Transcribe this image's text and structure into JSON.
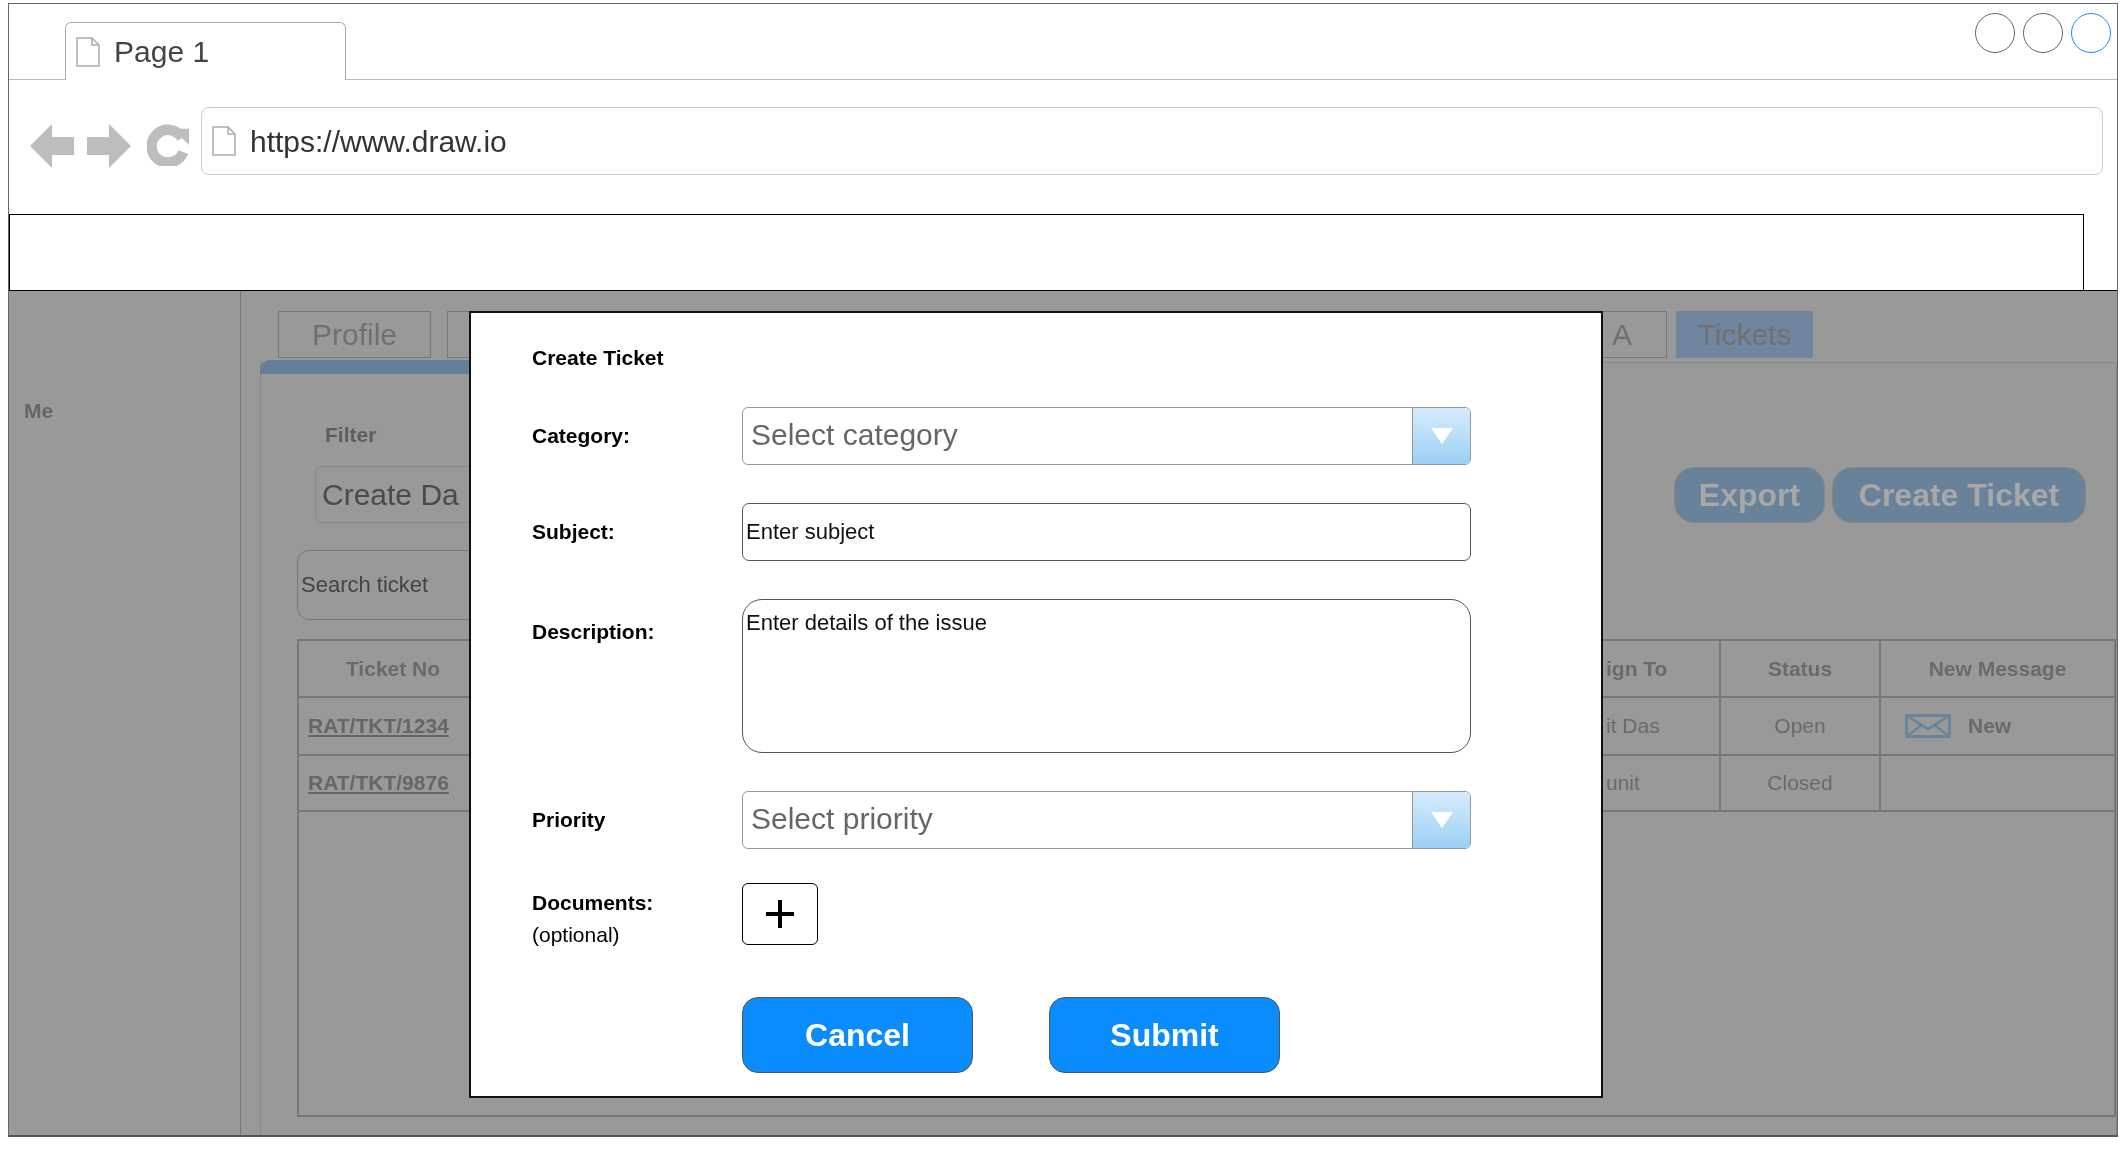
{
  "browser": {
    "tab_title": "Page 1",
    "url": "https://www.draw.io"
  },
  "sidebar": {
    "items": [
      {
        "label": "Me"
      }
    ]
  },
  "tabs": [
    {
      "label": "Profile",
      "selected": false
    },
    {
      "selected": false
    },
    {
      "label": "A",
      "selected": false
    },
    {
      "label": "Tickets",
      "selected": true
    }
  ],
  "filter": {
    "label": "Filter",
    "date_placeholder": "Create Da",
    "search_placeholder": "Search ticket"
  },
  "actions": [
    "Export",
    "Create Ticket"
  ],
  "table": {
    "columns": [
      "Ticket No",
      "ign To",
      "Status",
      "New Message"
    ],
    "rows": [
      [
        "RAT/TKT/1234",
        "it Das",
        "Open",
        "New"
      ],
      [
        "RAT/TKT/9876",
        "unit",
        "Closed",
        null
      ]
    ]
  },
  "dialog": {
    "title": "Create Ticket",
    "fields": [
      {
        "kind": "select",
        "label": "Category:",
        "placeholder": "Select category"
      },
      {
        "kind": "text",
        "label": "Subject:",
        "placeholder": "Enter subject"
      },
      {
        "kind": "textarea",
        "label": "Description:",
        "placeholder": "Enter details of the issue"
      },
      {
        "kind": "select",
        "label": "Priority",
        "placeholder": "Select priority"
      },
      {
        "kind": "upload",
        "label": "Documents:",
        "note": "(optional)"
      }
    ],
    "buttons": [
      "Cancel",
      "Submit"
    ]
  }
}
